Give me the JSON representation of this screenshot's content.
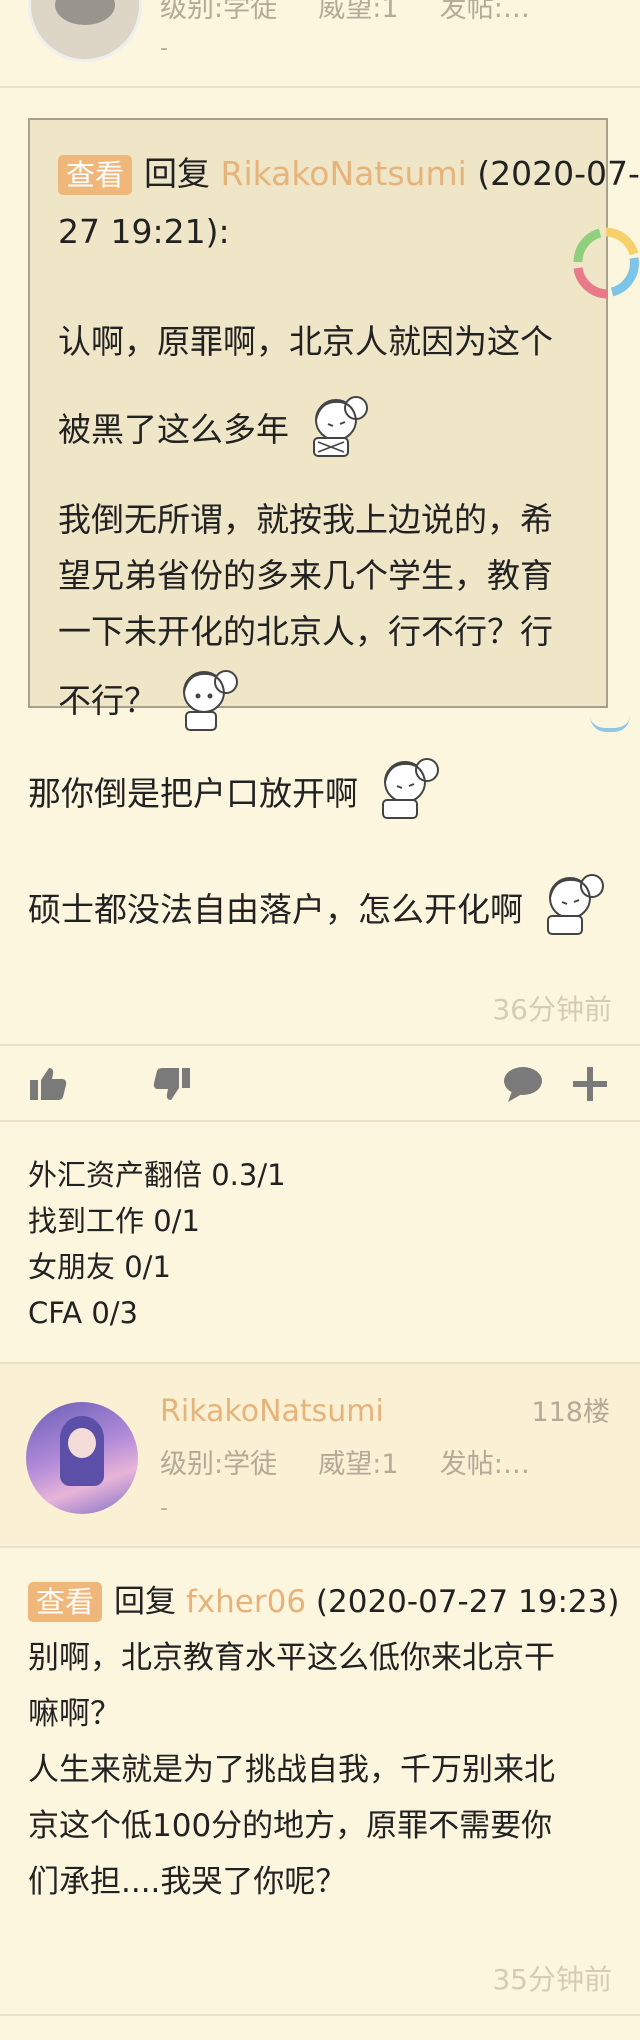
{
  "prev_post": {
    "level_label": "级别:学徒",
    "prestige_label": "威望:1",
    "posts_label": "发帖:…",
    "dash": "-"
  },
  "quote": {
    "tag": "查看",
    "reply_label": "回复",
    "reply_to": "RikakoNatsumi",
    "date_part1": "(2020-07-",
    "date_part2": "27 19:21):",
    "lines": [
      "认啊，原罪啊，北京人就因为这个",
      "被黑了这么多年",
      "我倒无所谓，就按我上边说的，希",
      "望兄弟省份的多来几个学生，教育",
      "一下未开化的北京人，行不行？行",
      "不行？"
    ]
  },
  "post_body": {
    "line1": "那你倒是把户口放开啊",
    "line2": "硕士都没法自由落户，怎么开化啊"
  },
  "post_time": "36分钟前",
  "signature": [
    "外汇资产翻倍 0.3/1",
    "找到工作 0/1",
    "女朋友 0/1",
    "CFA 0/3"
  ],
  "next_post": {
    "username": "RikakoNatsumi",
    "floor": "118楼",
    "level_label": "级别:学徒",
    "prestige_label": "威望:1",
    "posts_label": "发帖:…",
    "dash": "-",
    "tag": "查看",
    "reply_label": "回复",
    "reply_to": "fxher06",
    "reply_date": "(2020-07-27 19:23)",
    "lines": [
      "别啊，北京教育水平这么低你来北京干",
      "嘛啊？",
      "人生来就是为了挑战自我，千万别来北",
      "京这个低100分的地方，原罪不需要你",
      "们承担....我哭了你呢？"
    ],
    "time": "35分钟前"
  },
  "icons": {
    "like": "thumbs-up-icon",
    "dislike": "thumbs-down-icon",
    "comment": "comment-bubble-icon",
    "add": "plus-icon"
  },
  "colors": {
    "background": "#fdf6df",
    "accent": "#efb77a",
    "username": "#e6b37b",
    "muted": "#b3aa97"
  }
}
